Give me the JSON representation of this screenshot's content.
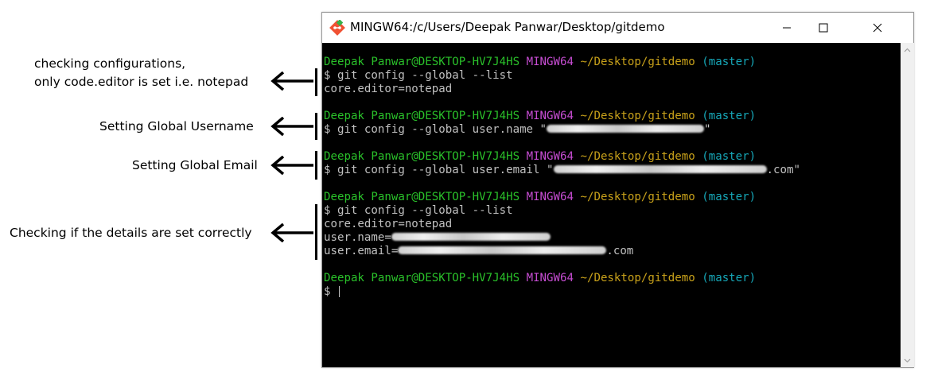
{
  "annotations": {
    "config_check_line1": "checking configurations,",
    "config_check_line2": "only code.editor is set i.e. notepad",
    "set_username": "Setting Global Username",
    "set_email": "Setting Global Email",
    "check_details": "Checking if the details are set correctly"
  },
  "window": {
    "title": "MINGW64:/c/Users/Deepak Panwar/Desktop/gitdemo",
    "minimize_icon": "minimize-icon",
    "maximize_icon": "maximize-icon",
    "close_icon": "close-icon",
    "app_icon": "git-logo-icon"
  },
  "terminal": {
    "user_host": "Deepak Panwar@DESKTOP-HV7J4HS",
    "shell": "MINGW64",
    "path": "~/Desktop/gitdemo",
    "branch": "(master)",
    "cmd1": "$ git config --global --list",
    "out1": "core.editor=notepad",
    "cmd2_prefix": "$ git config --global user.name \"",
    "cmd2_suffix": "\"",
    "cmd3_prefix": "$ git config --global user.email \"",
    "cmd3_suffix": ".com\"",
    "cmd4": "$ git config --global --list",
    "out4_1": "core.editor=notepad",
    "out4_2_prefix": "user.name=",
    "out4_3_prefix": "user.email=",
    "out4_3_suffix": ".com",
    "prompt": "$"
  },
  "colors": {
    "user_host": "#2ac12a",
    "shell": "#c74dd3",
    "path": "#c8a11a",
    "branch": "#16a7b8",
    "text": "#c0c0c0",
    "background": "#000000"
  }
}
